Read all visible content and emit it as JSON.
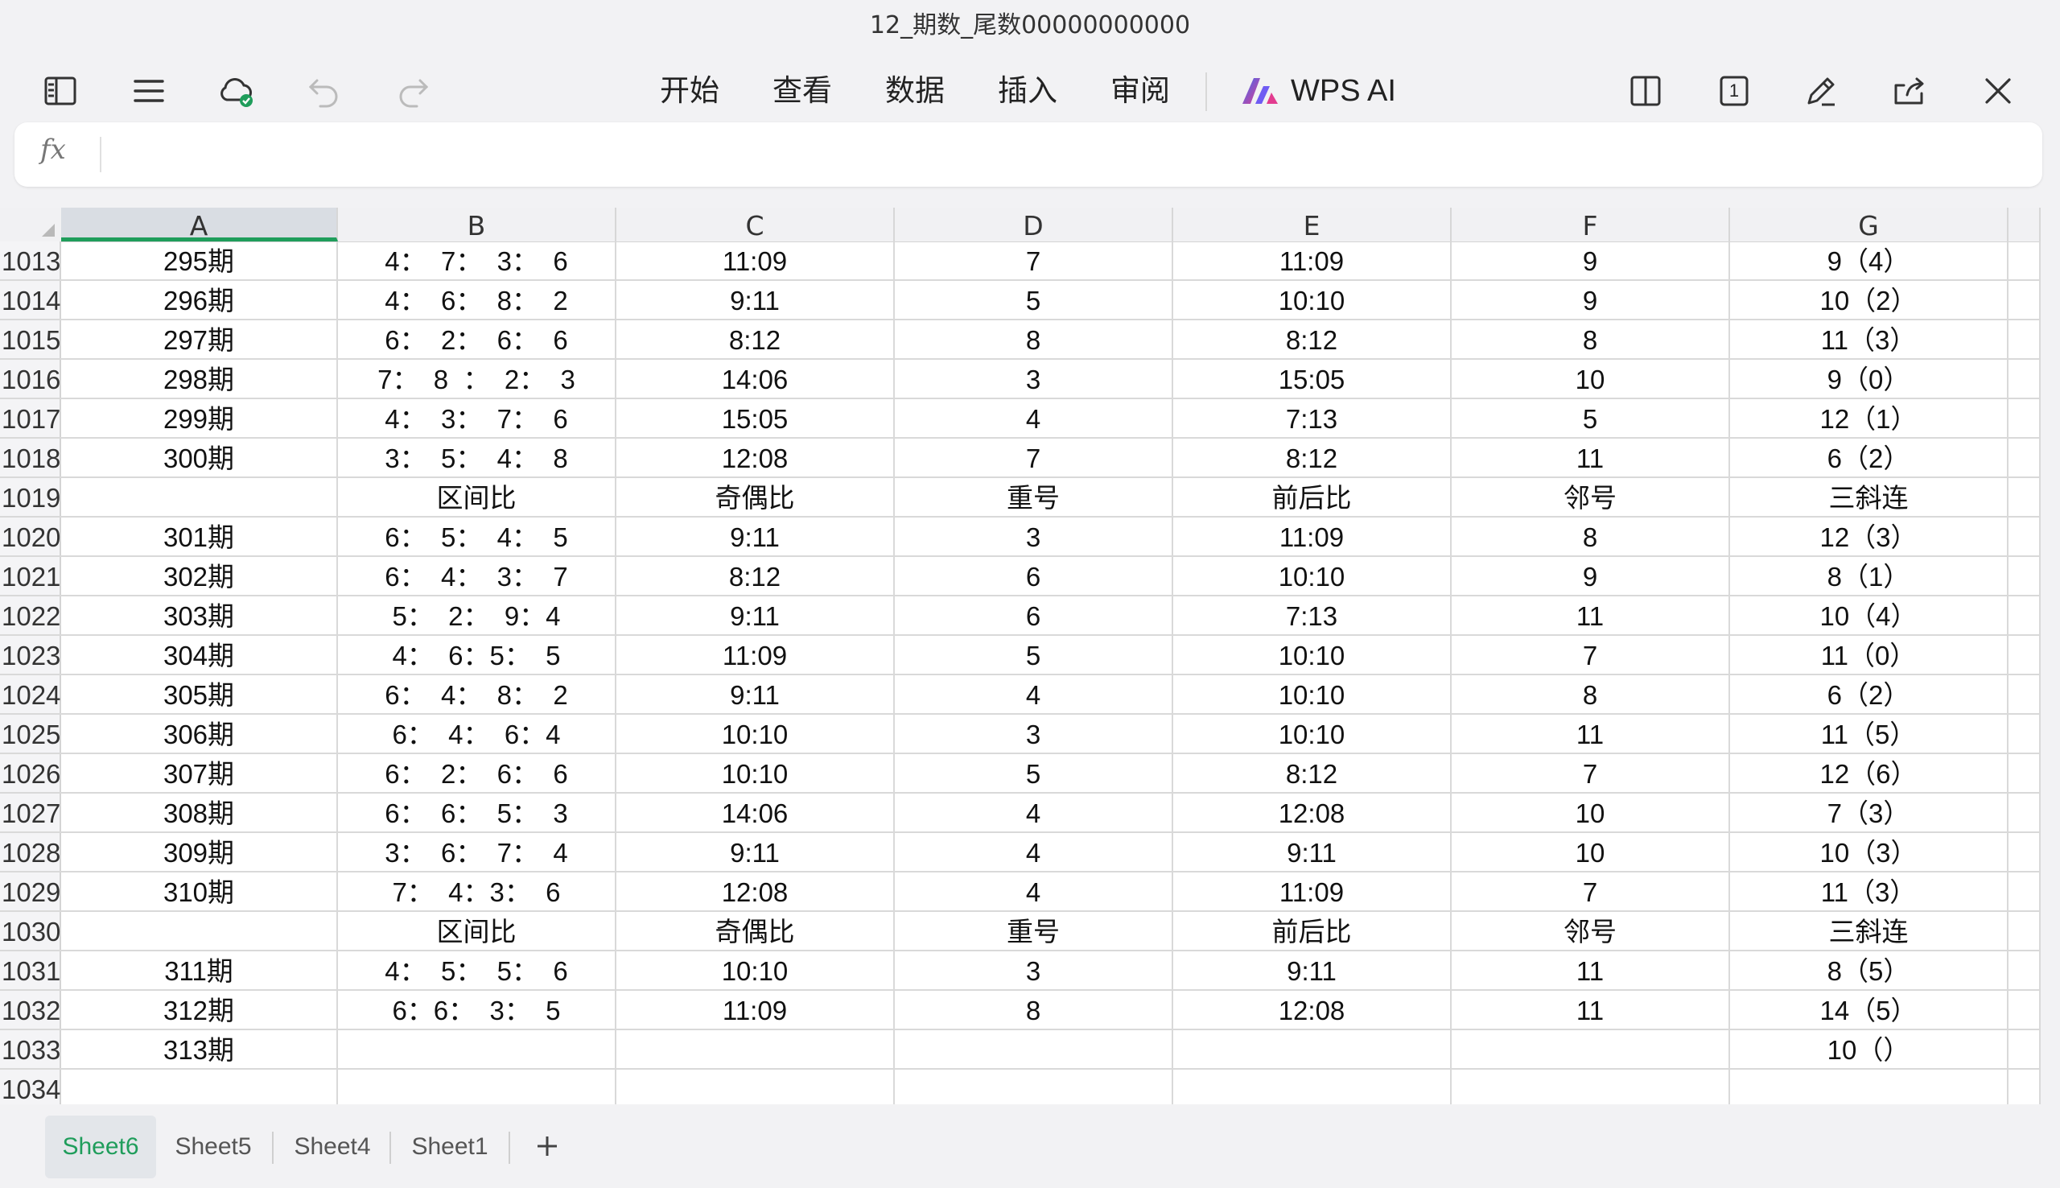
{
  "window": {
    "title": "12_期数_尾数00000000000"
  },
  "toolbar": {
    "menu": [
      "开始",
      "查看",
      "数据",
      "插入",
      "审阅"
    ],
    "ai_label": "WPS AI",
    "page_count": "1"
  },
  "formula_bar": {
    "fx_label": "fx",
    "value": ""
  },
  "columns": [
    "A",
    "B",
    "C",
    "D",
    "E",
    "F",
    "G"
  ],
  "rows": [
    {
      "num": "1013",
      "cells": [
        "295期",
        "4：  7：  3：  6",
        "11:09",
        "7",
        "11:09",
        "9",
        "9（4）"
      ]
    },
    {
      "num": "1014",
      "cells": [
        "296期",
        "4：  6：  8：  2",
        "9:11",
        "5",
        "10:10",
        "9",
        "10（2）"
      ]
    },
    {
      "num": "1015",
      "cells": [
        "297期",
        "6：  2：  6：  6",
        "8:12",
        "8",
        "8:12",
        "8",
        "11（3）"
      ]
    },
    {
      "num": "1016",
      "cells": [
        "298期",
        "7：  8  ：  2：  3",
        "14:06",
        "3",
        "15:05",
        "10",
        "9（0）"
      ]
    },
    {
      "num": "1017",
      "cells": [
        "299期",
        "4：  3：  7：  6",
        "15:05",
        "4",
        "7:13",
        "5",
        "12（1）"
      ]
    },
    {
      "num": "1018",
      "cells": [
        "300期",
        "3：  5：  4：  8",
        "12:08",
        "7",
        "8:12",
        "11",
        "6（2）"
      ]
    },
    {
      "num": "1019",
      "cells": [
        "",
        "区间比",
        "奇偶比",
        "重号",
        "前后比",
        "邻号",
        "三斜连"
      ]
    },
    {
      "num": "1020",
      "cells": [
        "301期",
        "6：  5：  4：  5",
        "9:11",
        "3",
        "11:09",
        "8",
        "12（3）"
      ]
    },
    {
      "num": "1021",
      "cells": [
        "302期",
        "6：  4：  3：  7",
        "8:12",
        "6",
        "10:10",
        "9",
        "8（1）"
      ]
    },
    {
      "num": "1022",
      "cells": [
        "303期",
        "5：  2：  9：4",
        "9:11",
        "6",
        "7:13",
        "11",
        "10（4）"
      ]
    },
    {
      "num": "1023",
      "cells": [
        "304期",
        "4：  6：5：  5",
        "11:09",
        "5",
        "10:10",
        "7",
        "11（0）"
      ]
    },
    {
      "num": "1024",
      "cells": [
        "305期",
        "6：  4：  8：  2",
        "9:11",
        "4",
        "10:10",
        "8",
        "6（2）"
      ]
    },
    {
      "num": "1025",
      "cells": [
        "306期",
        "6：  4：  6：4",
        "10:10",
        "3",
        "10:10",
        "11",
        "11（5）"
      ]
    },
    {
      "num": "1026",
      "cells": [
        "307期",
        "6：  2：  6：  6",
        "10:10",
        "5",
        "8:12",
        "7",
        "12（6）"
      ]
    },
    {
      "num": "1027",
      "cells": [
        "308期",
        "6：  6：  5：  3",
        "14:06",
        "4",
        "12:08",
        "10",
        "7（3）"
      ]
    },
    {
      "num": "1028",
      "cells": [
        "309期",
        "3：  6：  7：  4",
        "9:11",
        "4",
        "9:11",
        "10",
        "10（3）"
      ]
    },
    {
      "num": "1029",
      "cells": [
        "310期",
        "7：  4：3：  6",
        "12:08",
        "4",
        "11:09",
        "7",
        "11（3）"
      ]
    },
    {
      "num": "1030",
      "cells": [
        "",
        "区间比",
        "奇偶比",
        "重号",
        "前后比",
        "邻号",
        "三斜连"
      ]
    },
    {
      "num": "1031",
      "cells": [
        "311期",
        "4：  5：  5：  6",
        "10:10",
        "3",
        "9:11",
        "11",
        "8（5）"
      ]
    },
    {
      "num": "1032",
      "cells": [
        "312期",
        "6：6：  3：  5",
        "11:09",
        "8",
        "12:08",
        "11",
        "14（5）"
      ]
    },
    {
      "num": "1033",
      "cells": [
        "313期",
        "",
        "",
        "",
        "",
        "",
        "10（）"
      ]
    },
    {
      "num": "1034",
      "cells": [
        "",
        "",
        "",
        "",
        "",
        "",
        ""
      ]
    }
  ],
  "sheet_tabs": [
    "Sheet6",
    "Sheet5",
    "Sheet4",
    "Sheet1"
  ],
  "active_sheet": "Sheet6",
  "colors": {
    "accent_green": "#1f9d5b",
    "ai_gradient_start": "#3a6cf6",
    "ai_gradient_end": "#e23c8f"
  }
}
